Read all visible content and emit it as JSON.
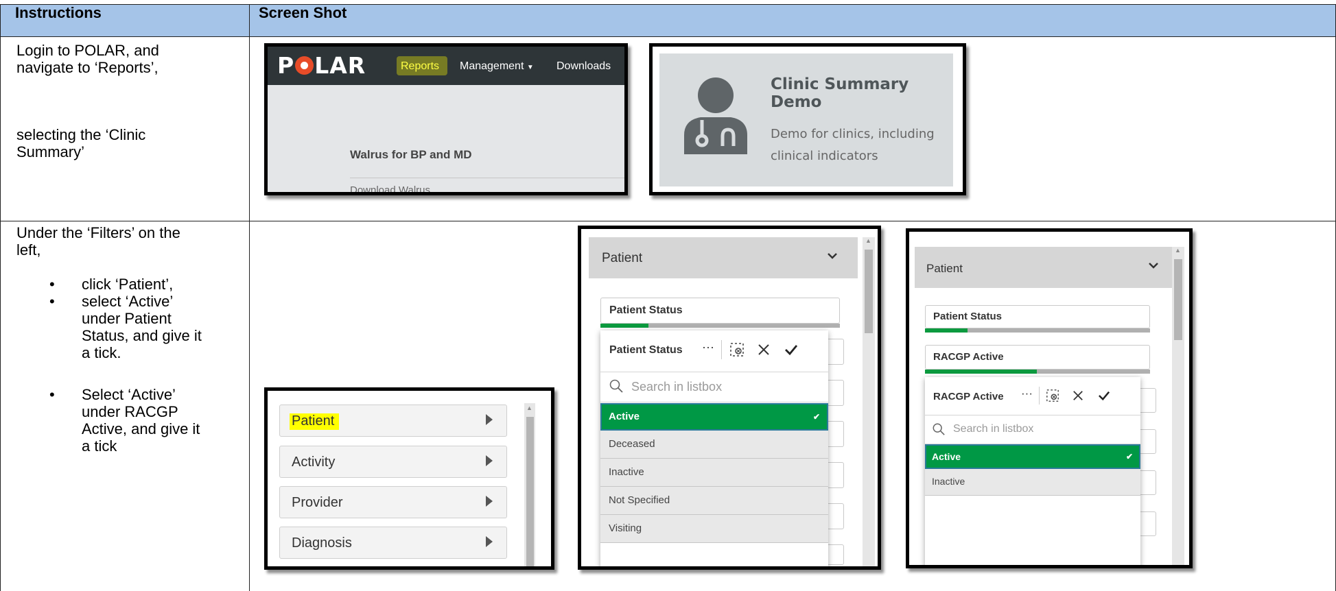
{
  "header": {
    "col1": "Instructions",
    "col2": "Screen Shot"
  },
  "row1": {
    "line1": "Login to POLAR, and",
    "line2": "navigate to ‘Reports’,",
    "line3": "selecting the ‘Clinic",
    "line4": "Summary’"
  },
  "row2": {
    "intro1": "Under the ‘Filters’ on the",
    "intro2": "left,",
    "b1_l1": "click ‘Patient’,",
    "b2_l1": "select ‘Active’",
    "b2_l2": "under Patient",
    "b2_l3": "Status, and give it",
    "b2_l4": "a tick.",
    "b3_l1": "Select ‘Active’",
    "b3_l2": "under RACGP",
    "b3_l3": "Active, and give it",
    "b3_l4": "a tick"
  },
  "nav": {
    "logo_p": "P",
    "logo_rest": "LAR",
    "reports": "Reports",
    "management": "Management",
    "downloads": "Downloads",
    "walrus_title": "Walrus for BP and MD",
    "walrus_link": "Download Walrus"
  },
  "clinic": {
    "title1": "Clinic Summary",
    "title2": "Demo",
    "desc1": "Demo for clinics, including",
    "desc2": "clinical indicators"
  },
  "filters": {
    "items": [
      "Patient",
      "Activity",
      "Provider",
      "Diagnosis"
    ]
  },
  "panel1": {
    "header": "Patient",
    "card1": "Patient Status",
    "popup_title": "Patient Status",
    "search": "Search in listbox",
    "options": [
      "Active",
      "Deceased",
      "Inactive",
      "Not Specified",
      "Visiting"
    ]
  },
  "panel2": {
    "header": "Patient",
    "card1": "Patient Status",
    "card2": "RACGP Active",
    "popup_title": "RACGP Active",
    "search": "Search in listbox",
    "options": [
      "Active",
      "Inactive"
    ]
  },
  "colors": {
    "header_bg": "#a5c4e8",
    "selected": "#009845",
    "highlight": "#ffff00",
    "logo_accent": "#e84c28"
  }
}
